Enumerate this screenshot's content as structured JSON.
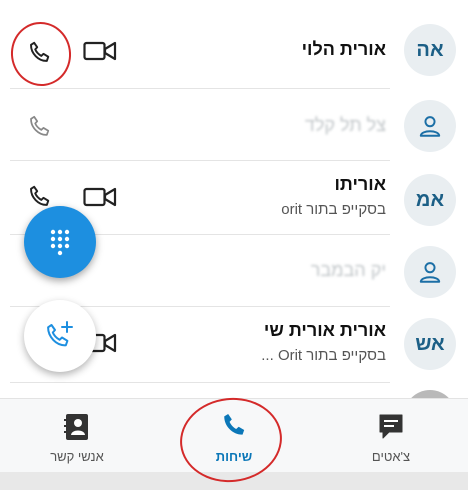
{
  "contacts": [
    {
      "initials": "אה",
      "name": "אורית הלוי",
      "subtitle": ""
    },
    {
      "initials": "",
      "name": "צל תל קלד",
      "subtitle": ""
    },
    {
      "initials": "אמ",
      "name": "אוריתו",
      "subtitle": "בסקייפ בתור orit"
    },
    {
      "initials": "",
      "name": "יק הבמבר",
      "subtitle": ""
    },
    {
      "initials": "אש",
      "name": "אורית אורית שי",
      "subtitle": "בסקייפ בתור Orit ..."
    }
  ],
  "nav": {
    "contacts_label": "אנשי קשר",
    "calls_label": "שיחות",
    "chats_label": "צ'אטים"
  },
  "colors": {
    "accent": "#0b77b8",
    "fab": "#1d8fe0",
    "annotation": "#d42a2a"
  }
}
